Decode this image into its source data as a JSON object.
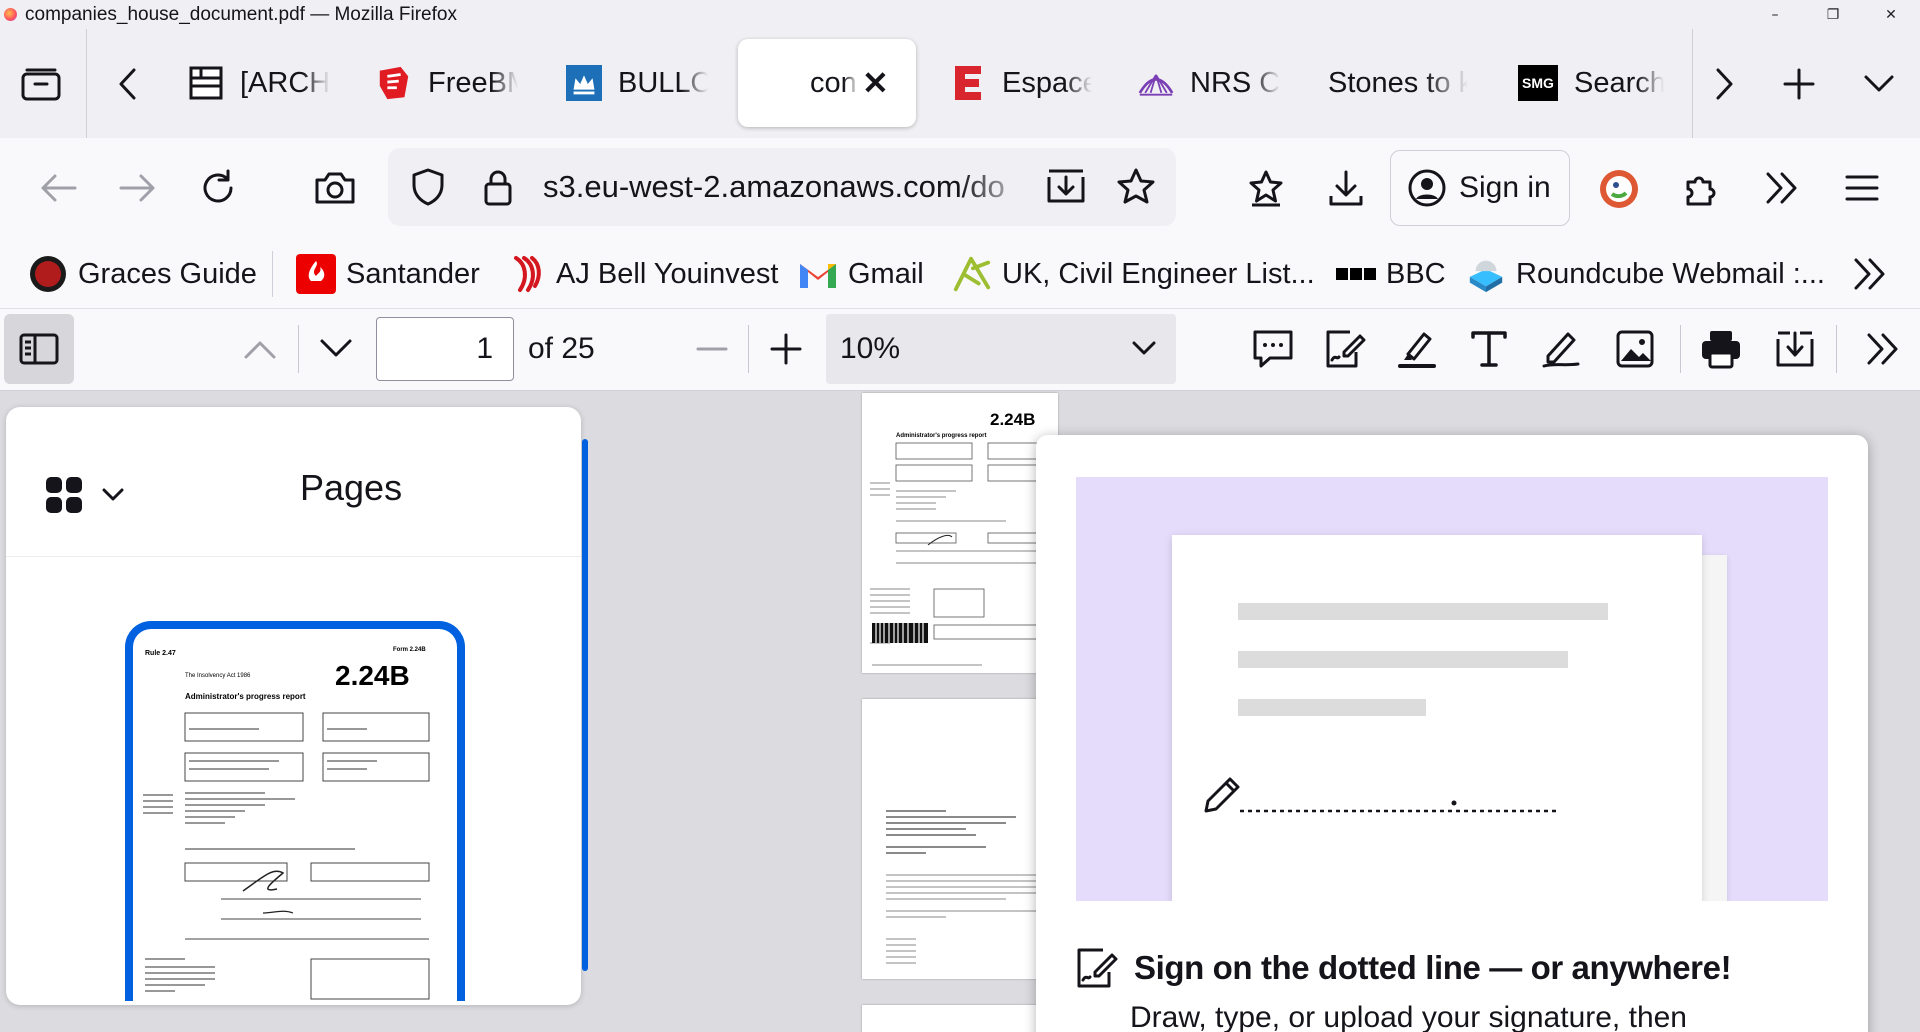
{
  "window": {
    "title": "companies_house_document.pdf — Mozilla Firefox",
    "controls": {
      "minimize": "–",
      "maximize": "❐",
      "close": "✕"
    }
  },
  "tabs": [
    {
      "label": "[ARCH",
      "icon": "archive-icon"
    },
    {
      "label": "FreeBM",
      "icon": "freebmd-icon"
    },
    {
      "label": "BULLO",
      "icon": "crown-icon"
    },
    {
      "label": "con",
      "icon": "pdf-icon",
      "active": true
    },
    {
      "label": "Espace",
      "icon": "e-logo-icon"
    },
    {
      "label": "NRS C",
      "icon": "nrs-icon"
    },
    {
      "label": "Stones to k",
      "icon": ""
    },
    {
      "label": "Search",
      "icon": "smg-icon",
      "badge": "SMG"
    }
  ],
  "navbar": {
    "url": "s3.eu-west-2.amazonaws.com/do",
    "signin_label": "Sign in"
  },
  "bookmarks": [
    {
      "label": "Graces Guide",
      "icon": "graces-guide-icon"
    },
    {
      "label": "Santander",
      "icon": "santander-icon"
    },
    {
      "label": "AJ Bell Youinvest",
      "icon": "ajbell-icon"
    },
    {
      "label": "Gmail",
      "icon": "gmail-icon"
    },
    {
      "label": "UK, Civil Engineer List...",
      "icon": "ancestry-icon"
    },
    {
      "label": "BBC",
      "icon": "bbc-icon"
    },
    {
      "label": "Roundcube Webmail :...",
      "icon": "roundcube-icon"
    }
  ],
  "pdf_toolbar": {
    "page_number": "1",
    "page_of": "of 25",
    "zoom": "10%"
  },
  "sidebar": {
    "title": "Pages"
  },
  "thumbnail": {
    "rule": "Rule 2.47",
    "form": "Form 2.24B",
    "big_title": "2.24B",
    "act": "The Insolvency Act 1986",
    "heading": "Administrator's progress report"
  },
  "page1": {
    "big_title": "2.24B",
    "heading": "Administrator's progress report"
  },
  "popup": {
    "heading": "Sign on the dotted line — or anywhere!",
    "body": "Draw, type, or upload your signature, then"
  },
  "colors": {
    "accent": "#0061e0",
    "illustration_bg": "#e5dcfb"
  }
}
